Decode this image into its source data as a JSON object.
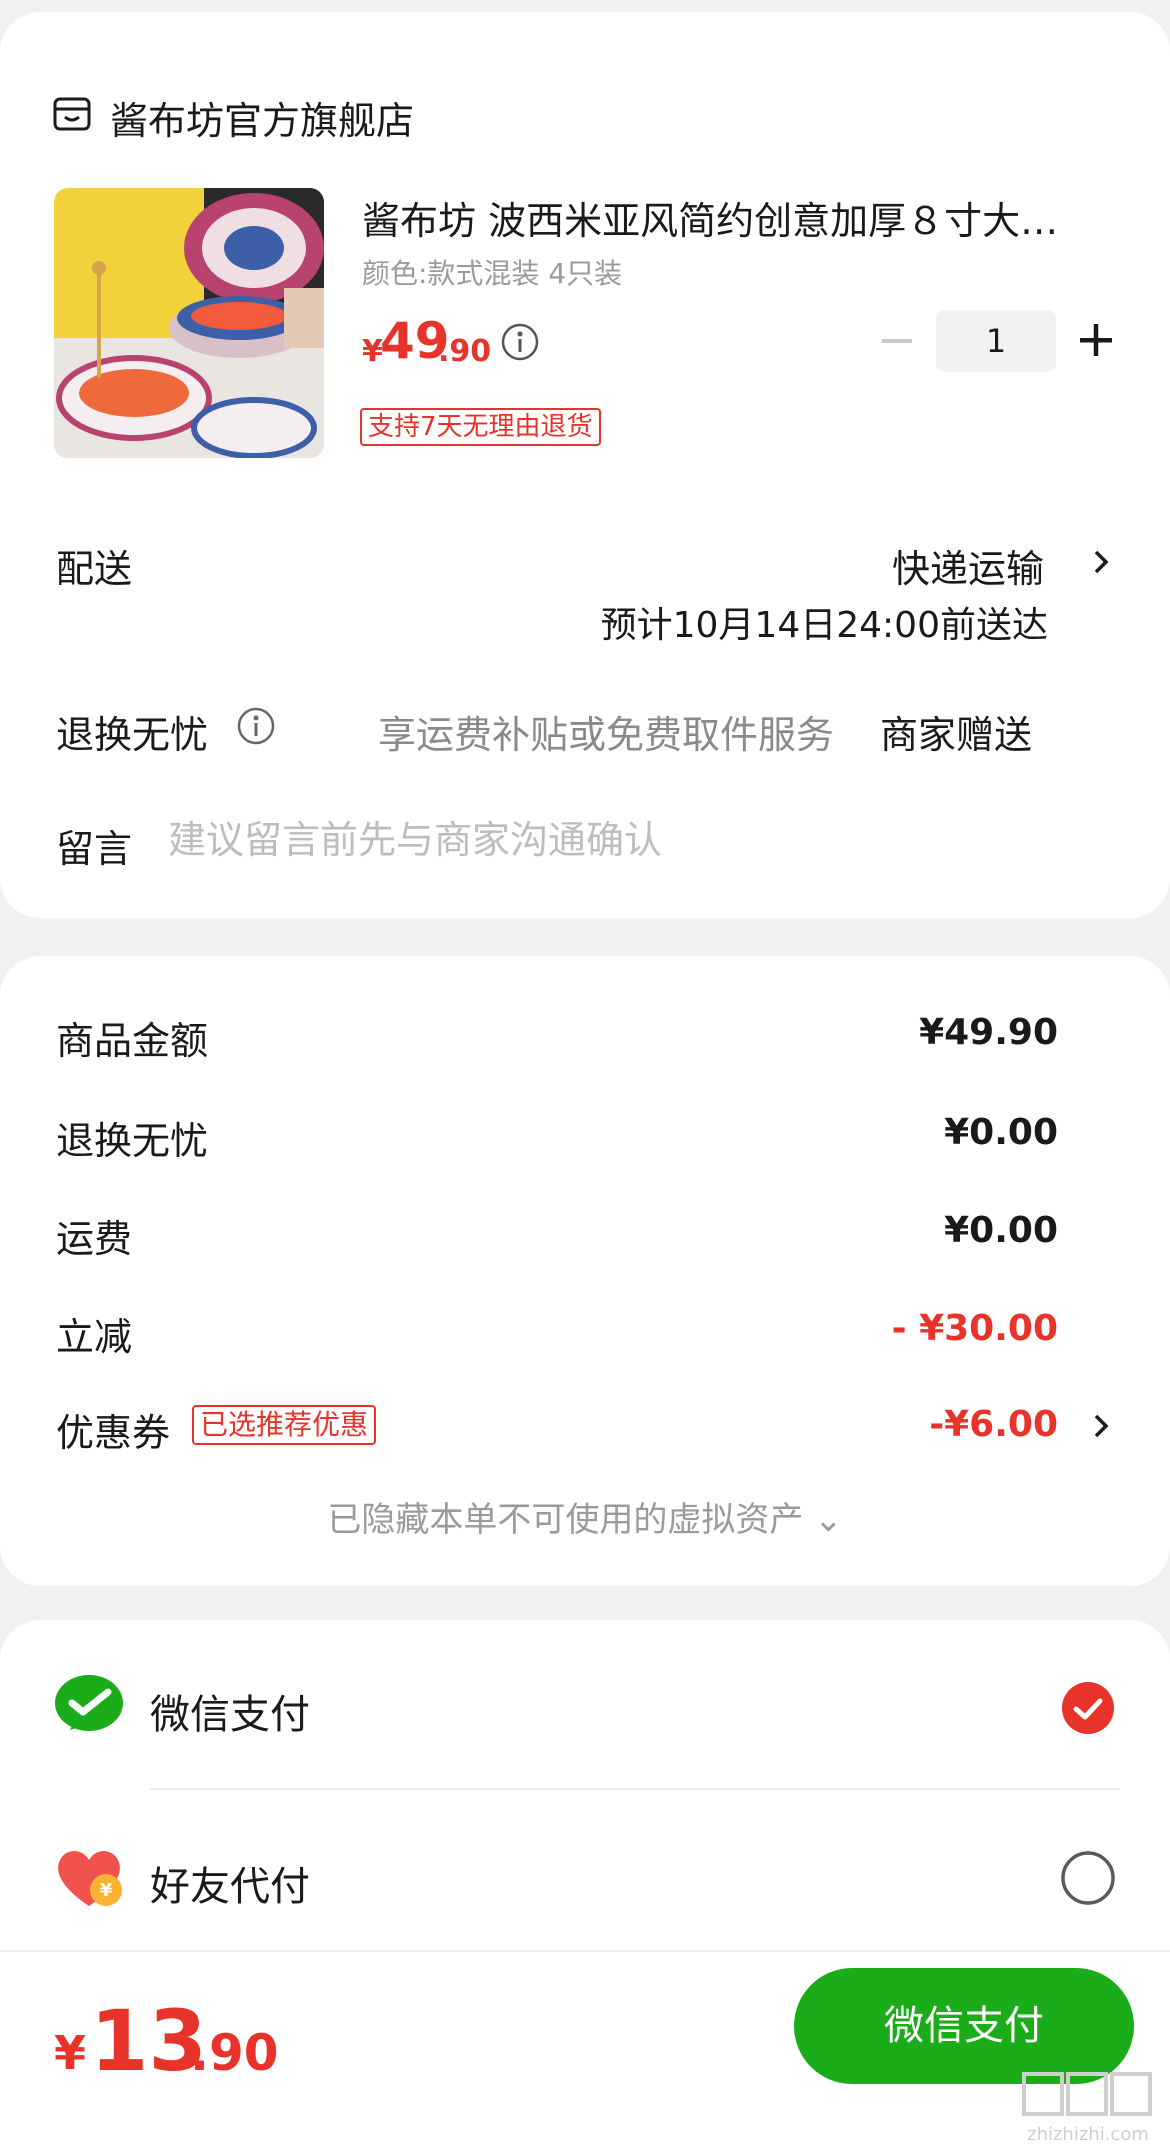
{
  "store": {
    "name": "酱布坊官方旗舰店",
    "icon": "store-icon"
  },
  "product": {
    "title": "酱布坊 波西米亚风简约创意加厚８寸大…",
    "spec": "颜色:款式混装 4只装",
    "price_symbol": "¥",
    "price_int": "49",
    "price_dec": ".90",
    "quantity": "1",
    "return_tag": "支持7天无理由退货",
    "image_icon": "bohemian-bowls-photo"
  },
  "delivery": {
    "label": "配送",
    "method": "快递运输",
    "eta": "预计10月14日24:00前送达"
  },
  "return_exchange": {
    "label": "退换无忧",
    "desc": "享运费补贴或免费取件服务",
    "value": "商家赠送"
  },
  "note": {
    "label": "留言",
    "placeholder": "建议留言前先与商家沟通确认"
  },
  "summary": {
    "goods_label": "商品金额",
    "goods_value": "¥49.90",
    "rx_label": "退换无忧",
    "rx_value": "¥0.00",
    "shipping_label": "运费",
    "shipping_value": "¥0.00",
    "discount_label": "立减",
    "discount_value": "- ¥30.00",
    "coupon_label": "优惠券",
    "coupon_tag": "已选推荐优惠",
    "coupon_value": "-¥6.00",
    "hidden_assets": "已隐藏本单不可使用的虚拟资产 ⌄"
  },
  "payment": {
    "wechat_label": "微信支付",
    "friend_label": "好友代付",
    "wechat_selected": true
  },
  "footer": {
    "total_symbol": "¥",
    "total_int": "13",
    "total_dec": ".90",
    "pay_button": "微信支付",
    "watermark": "zhizhizhi.com"
  },
  "colors": {
    "accent_red": "#e8332a",
    "wechat_green": "#1aad19",
    "background": "#f1f1f1"
  }
}
